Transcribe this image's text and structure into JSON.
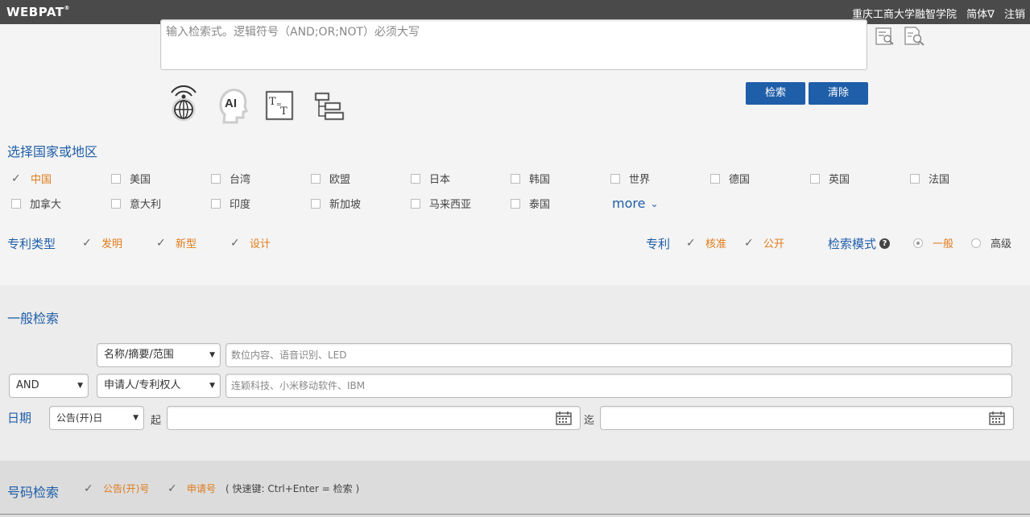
{
  "header": {
    "logo": "WEBPAT",
    "org": "重庆工商大学融智学院",
    "lang": "简体∇",
    "logout": "注销"
  },
  "query": {
    "placeholder": "输入检索式。逻辑符号（AND;OR;NOT）必须大写",
    "search_label": "检索",
    "clear_label": "清除"
  },
  "tools": [
    {
      "icon": "broadcast-icon"
    },
    {
      "icon": "ai-head-icon",
      "text": "AI"
    },
    {
      "icon": "text-format-icon"
    },
    {
      "icon": "tree-icon"
    }
  ],
  "country": {
    "title": "选择国家或地区",
    "items": [
      {
        "label": "中国",
        "checked": true
      },
      {
        "label": "美国",
        "checked": false
      },
      {
        "label": "台湾",
        "checked": false
      },
      {
        "label": "欧盟",
        "checked": false
      },
      {
        "label": "日本",
        "checked": false
      },
      {
        "label": "韩国",
        "checked": false
      },
      {
        "label": "世界",
        "checked": false
      },
      {
        "label": "德国",
        "checked": false
      },
      {
        "label": "英国",
        "checked": false
      },
      {
        "label": "法国",
        "checked": false
      },
      {
        "label": "加拿大",
        "checked": false
      },
      {
        "label": "意大利",
        "checked": false
      },
      {
        "label": "印度",
        "checked": false
      },
      {
        "label": "新加坡",
        "checked": false
      },
      {
        "label": "马来西亚",
        "checked": false
      },
      {
        "label": "泰国",
        "checked": false
      }
    ],
    "more": "more"
  },
  "patent_type": {
    "title": "专利类型",
    "items": [
      "发明",
      "新型",
      "设计"
    ]
  },
  "patent": {
    "title": "专利",
    "items": [
      "核准",
      "公开"
    ]
  },
  "mode": {
    "title": "检索模式",
    "help": "?",
    "options": [
      "一般",
      "高级"
    ],
    "selected": "一般"
  },
  "general": {
    "title": "一般检索",
    "operator": "AND",
    "field1": "名称/摘要/范围",
    "field1_placeholder": "数位内容、语音识别、LED",
    "field2": "申请人/专利权人",
    "field2_placeholder": "连颖科技、小米移动软件、IBM",
    "date_label": "日期",
    "date_type": "公告(开)日",
    "from": "起",
    "to": "迄"
  },
  "number": {
    "title": "号码检索",
    "opt1": "公告(开)号",
    "opt2": "申请号",
    "hint": "( 快速键: Ctrl+Enter = 检索 )"
  },
  "colors": {
    "accent": "#1f5ea8",
    "orange": "#e07b1a",
    "topbar": "#4a4a4a"
  }
}
